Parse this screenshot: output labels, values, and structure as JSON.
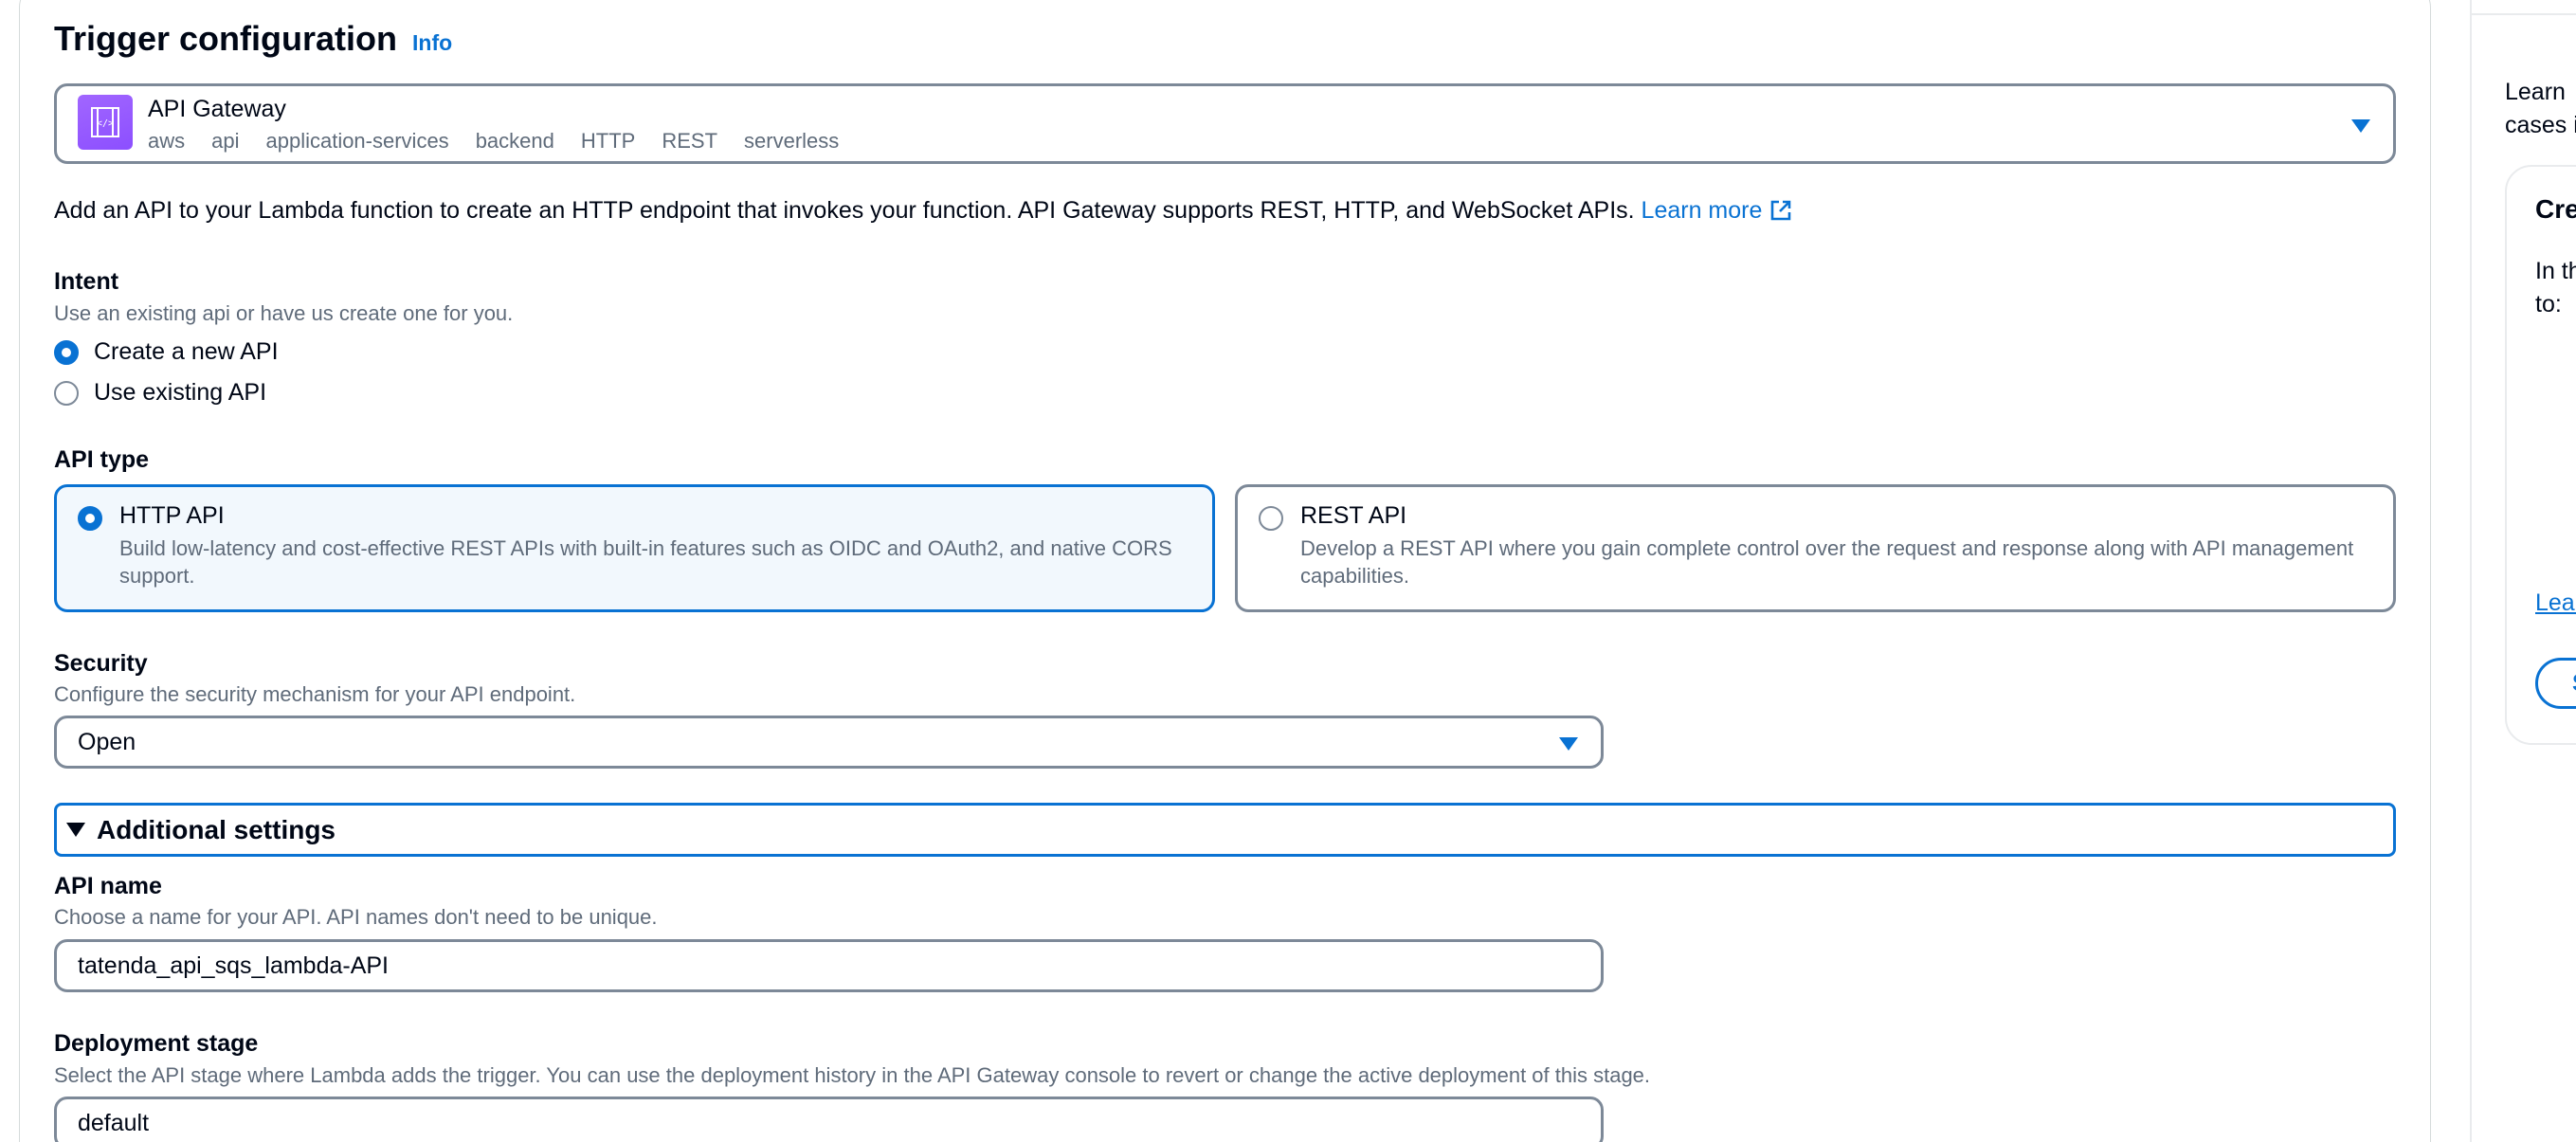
{
  "section": {
    "title": "Trigger configuration",
    "info_link": "Info"
  },
  "trigger": {
    "name": "API Gateway",
    "tags": [
      "aws",
      "api",
      "application-services",
      "backend",
      "HTTP",
      "REST",
      "serverless"
    ],
    "icon": "api-gateway-icon"
  },
  "description": {
    "text": "Add an API to your Lambda function to create an HTTP endpoint that invokes your function. API Gateway supports REST, HTTP, and WebSocket APIs. ",
    "learn_more": "Learn more"
  },
  "intent": {
    "label": "Intent",
    "description": "Use an existing api or have us create one for you.",
    "options": [
      "Create a new API",
      "Use existing API"
    ],
    "selected": "Create a new API"
  },
  "api_type": {
    "label": "API type",
    "options": [
      {
        "title": "HTTP API",
        "description": "Build low-latency and cost-effective REST APIs with built-in features such as OIDC and OAuth2, and native CORS support.",
        "selected": true
      },
      {
        "title": "REST API",
        "description": "Develop a REST API where you gain complete control over the request and response along with API management capabilities.",
        "selected": false
      }
    ]
  },
  "security": {
    "label": "Security",
    "description": "Configure the security mechanism for your API endpoint.",
    "value": "Open"
  },
  "additional_settings": {
    "label": "Additional settings",
    "expanded": true
  },
  "api_name": {
    "label": "API name",
    "description": "Choose a name for your API. API names don't need to be unique.",
    "value": "tatenda_api_sqs_lambda-API"
  },
  "deployment_stage": {
    "label": "Deployment stage",
    "description": "Select the API stage where Lambda adds the trigger. You can use the deployment history in the API Gateway console to revert or change the active deployment of this stage.",
    "value": "default"
  },
  "help_panel": {
    "line1": "Learn",
    "line2": "cases i",
    "card_title": "Cre",
    "card_line1": "In th",
    "card_line2": "to:",
    "link": "Lear",
    "button": "S"
  },
  "colors": {
    "accent": "#0972d3",
    "border": "#7d8998",
    "muted_text": "#5f6b7a",
    "icon_purple": "#8c4fff",
    "selected_tile_bg": "#f2f8fd"
  }
}
